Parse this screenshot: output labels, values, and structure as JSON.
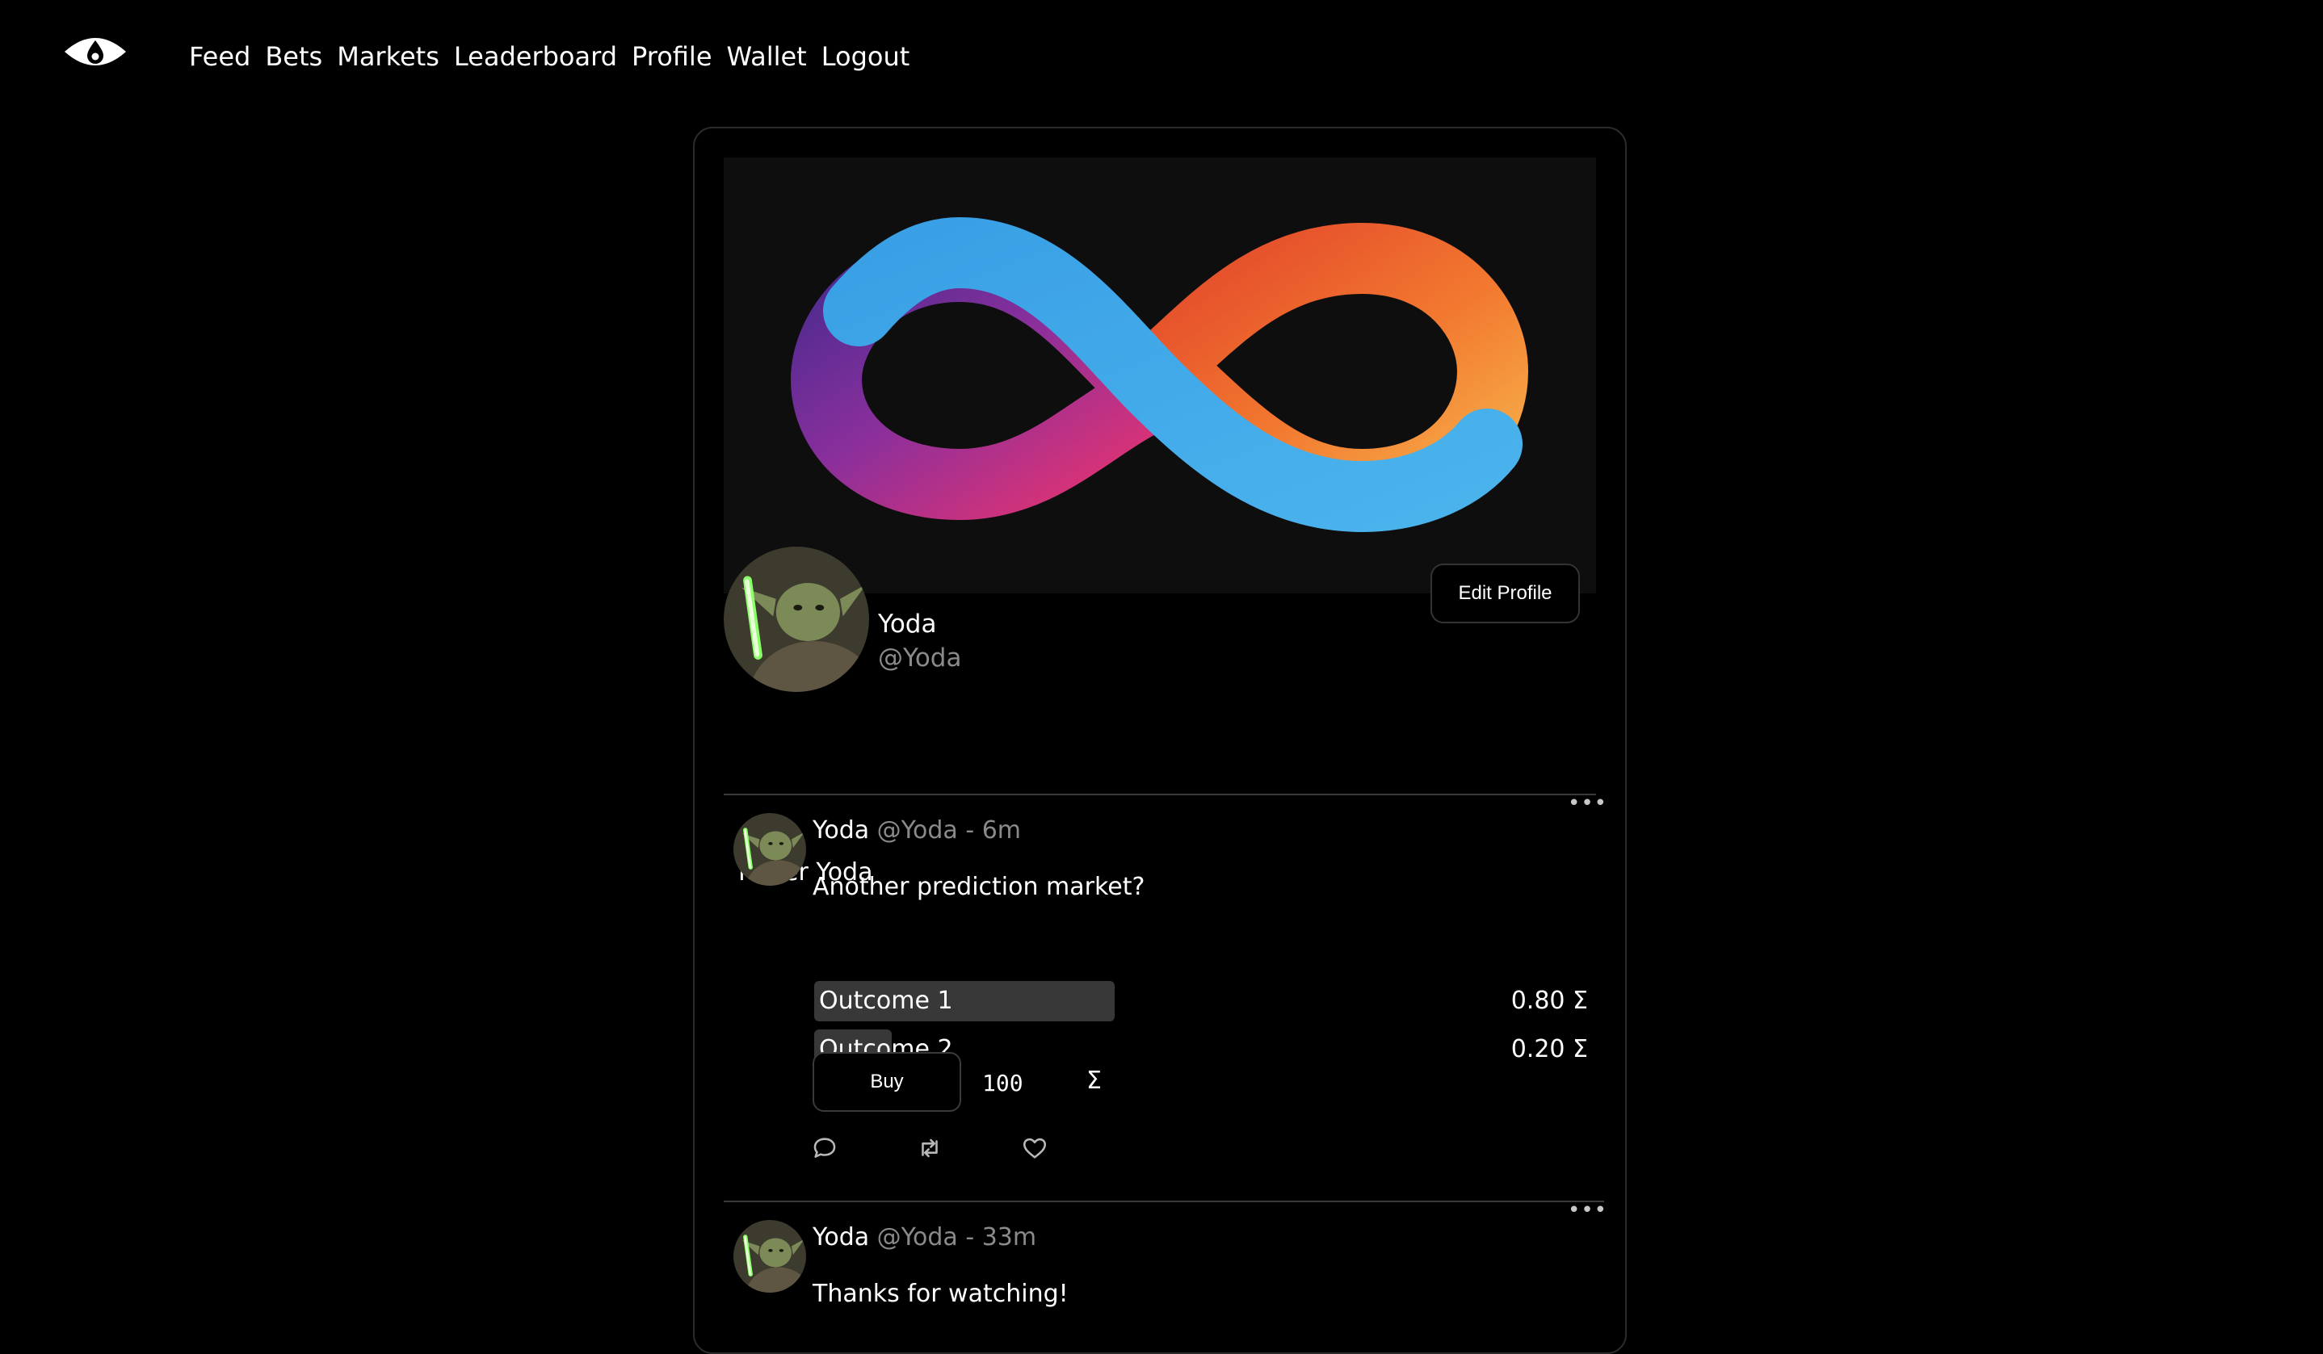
{
  "nav": {
    "logo_icon": "eye-icon",
    "links": [
      "Feed",
      "Bets",
      "Markets",
      "Leaderboard",
      "Profile",
      "Wallet",
      "Logout"
    ]
  },
  "profile": {
    "display_name": "Yoda",
    "handle": "@Yoda",
    "bio": "Mater Yoda",
    "edit_label": "Edit Profile",
    "banner_icon": "infinity-logo",
    "avatar_icon": "yoda-avatar"
  },
  "posts": [
    {
      "name": "Yoda",
      "handle": "@Yoda",
      "separator": "-",
      "time": "6m",
      "text": "Another prediction market?",
      "outcomes": [
        {
          "label": "Outcome 1",
          "price": "0.80 Σ",
          "probability": 0.8
        },
        {
          "label": "Outcome 2",
          "price": "0.20 Σ",
          "probability": 0.2
        }
      ],
      "buy_label": "Buy",
      "amount": "100",
      "currency": "Σ",
      "more_icon": "ellipsis-icon",
      "action_icons": [
        "comment-icon",
        "repost-icon",
        "heart-icon"
      ]
    },
    {
      "name": "Yoda",
      "handle": "@Yoda",
      "separator": "-",
      "time": "33m",
      "text": "Thanks for watching!",
      "more_icon": "ellipsis-icon"
    }
  ],
  "colors": {
    "background": "#000000",
    "banner_bg": "#0e0e0e",
    "muted_text": "#8a8a8a",
    "outcome_bar": "#383838",
    "border": "#333333"
  }
}
